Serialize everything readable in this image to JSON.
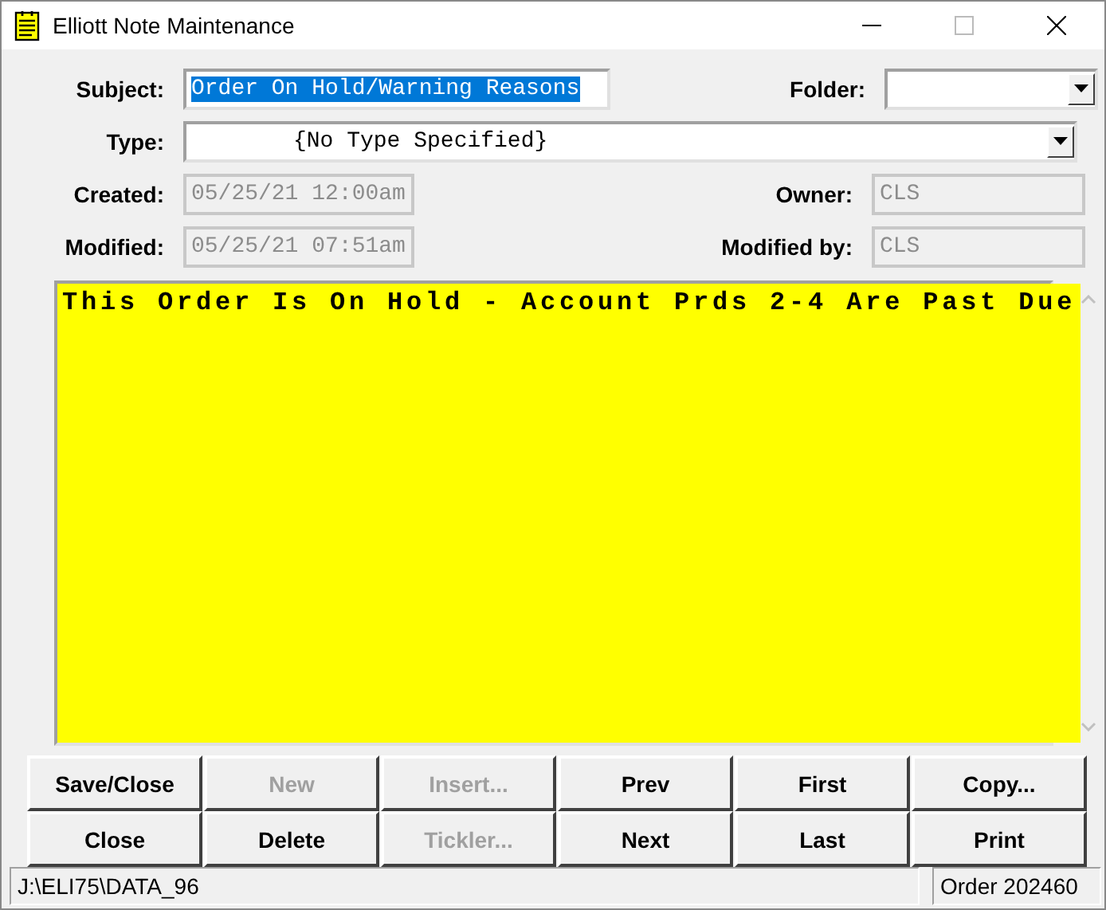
{
  "window": {
    "title": "Elliott Note Maintenance"
  },
  "fields": {
    "subject": {
      "label": "Subject:",
      "value": "Order On Hold/Warning Reasons",
      "selected": true
    },
    "folder": {
      "label": "Folder:"
    },
    "type": {
      "label": "Type:",
      "value": "{No Type Specified}"
    },
    "created": {
      "label": "Created:",
      "value": "05/25/21 12:00am",
      "disabled": true
    },
    "owner": {
      "label": "Owner:",
      "value": "CLS",
      "disabled": true
    },
    "modified": {
      "label": "Modified:",
      "value": "05/25/21 07:51am",
      "disabled": true
    },
    "modified_by": {
      "label": "Modified by:",
      "value": "CLS",
      "disabled": true
    }
  },
  "note": {
    "text": "This Order Is On Hold - Account Prds 2-4 Are Past Due"
  },
  "buttons": [
    {
      "label": "Save/Close",
      "disabled": false
    },
    {
      "label": "New",
      "disabled": true
    },
    {
      "label": "Insert...",
      "disabled": true
    },
    {
      "label": "Prev",
      "disabled": false
    },
    {
      "label": "First",
      "disabled": false
    },
    {
      "label": "Copy...",
      "disabled": false
    },
    {
      "label": "Close",
      "disabled": false
    },
    {
      "label": "Delete",
      "disabled": false
    },
    {
      "label": "Tickler...",
      "disabled": true
    },
    {
      "label": "Next",
      "disabled": false
    },
    {
      "label": "Last",
      "disabled": false
    },
    {
      "label": "Print",
      "disabled": false
    }
  ],
  "status_bar": {
    "path": "J:\\ELI75\\DATA_96",
    "record": "Order 202460"
  }
}
